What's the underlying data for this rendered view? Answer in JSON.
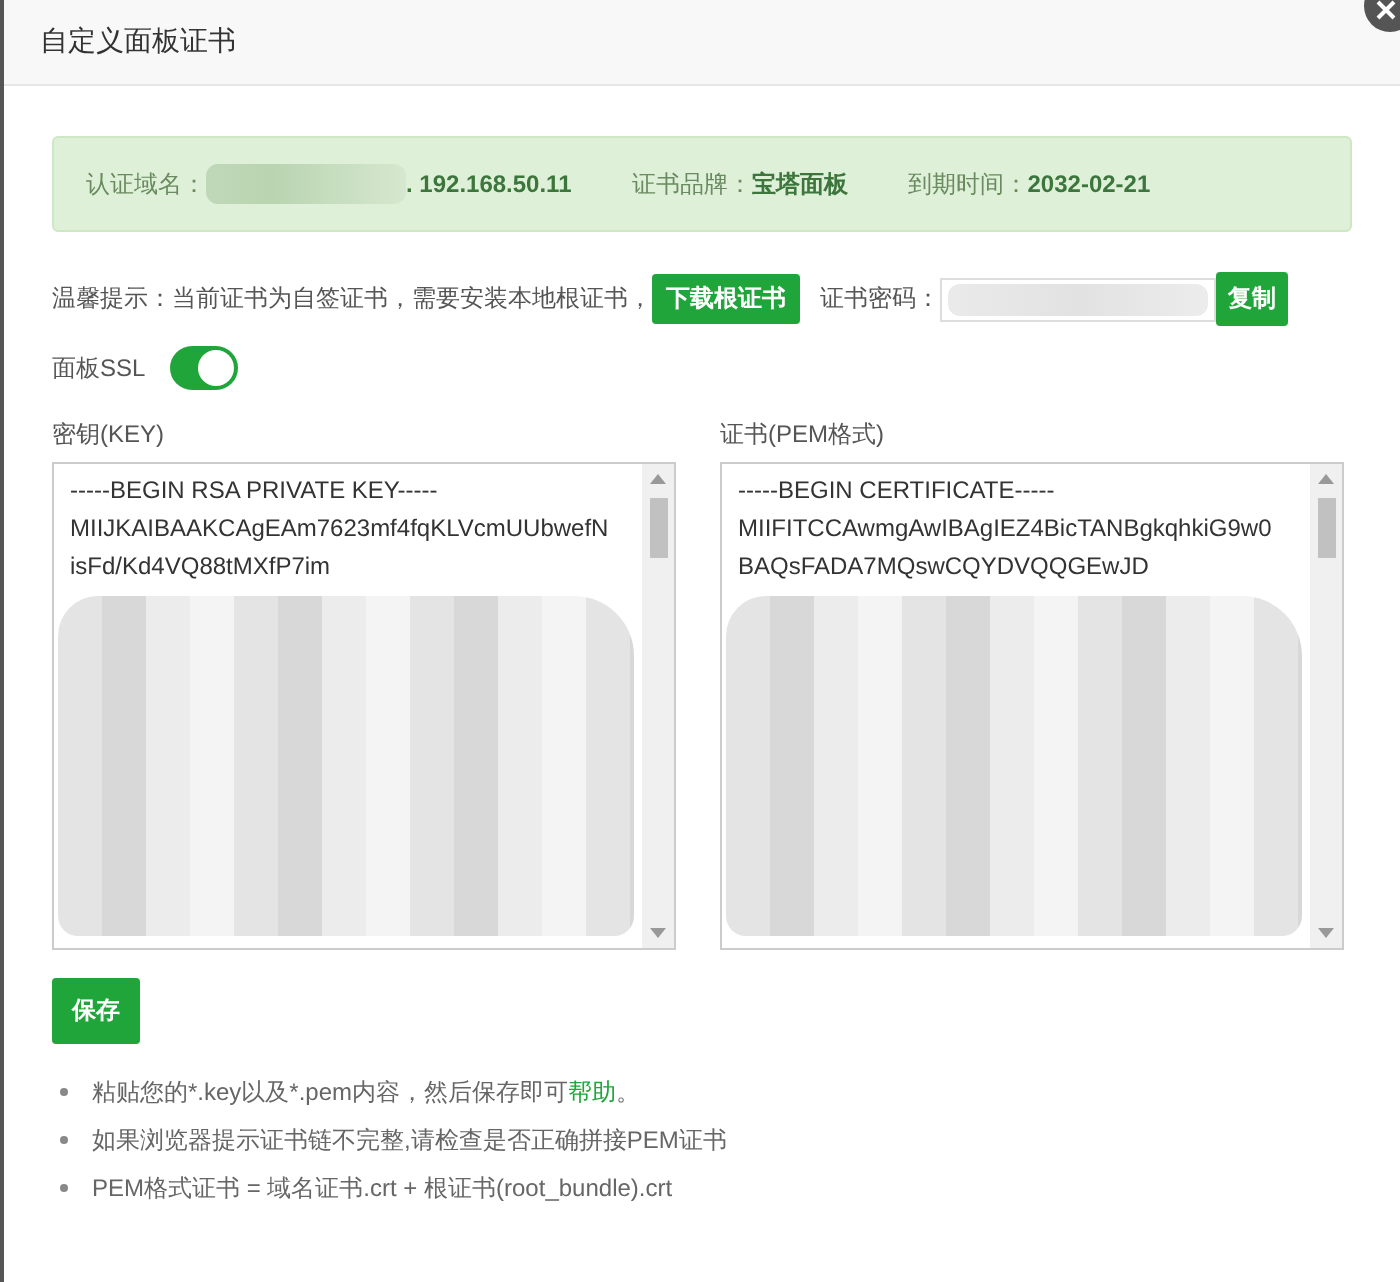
{
  "window": {
    "title": "自定义面板证书"
  },
  "cert_info": [
    {
      "label": "认证域名：",
      "value": ". 192.168.50.11",
      "redacted": true
    },
    {
      "label": "证书品牌：",
      "value": "宝塔面板"
    },
    {
      "label": "到期时间：",
      "value": "2032-02-21"
    }
  ],
  "tip": {
    "text": "温馨提示：当前证书为自签证书，需要安装本地根证书，",
    "download_button": "下载根证书",
    "password_label": "证书密码：",
    "copy_button": "复制"
  },
  "ssl": {
    "label": "面板SSL",
    "on": true
  },
  "editors": [
    {
      "label": "密钥(KEY)",
      "lines": [
        "-----BEGIN RSA PRIVATE KEY-----",
        "MIIJKAIBAAKCAgEAm7623mf4fqKLVcmUUbwefN",
        "isFd/Kd4VQ88tMXfP7im"
      ]
    },
    {
      "label": "证书(PEM格式)",
      "lines": [
        "-----BEGIN CERTIFICATE-----",
        "MIIFITCCAwmgAwIBAgIEZ4BicTANBgkqhkiG9w0",
        "BAQsFADA7MQswCQYDVQQGEwJD"
      ]
    }
  ],
  "save_button": "保存",
  "notes": [
    {
      "text": "粘贴您的*.key以及*.pem内容，然后保存即可",
      "link": "帮助",
      "after": "。"
    },
    {
      "text": "如果浏览器提示证书链不完整,请检查是否正确拼接PEM证书"
    },
    {
      "text": "PEM格式证书 = 域名证书.crt + 根证书(root_bundle).crt"
    }
  ]
}
